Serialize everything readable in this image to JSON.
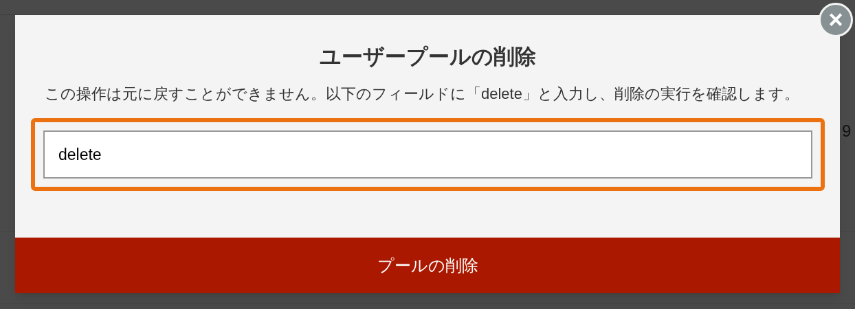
{
  "background": {
    "cell_text": "9"
  },
  "dialog": {
    "title": "ユーザープールの削除",
    "message": "この操作は元に戻すことができません。以下のフィールドに「delete」と入力し、削除の実行を確認します。",
    "confirm_field": {
      "value": "delete",
      "focused": true
    },
    "delete_button": "プールの削除",
    "close_button": {
      "label": "×"
    }
  }
}
